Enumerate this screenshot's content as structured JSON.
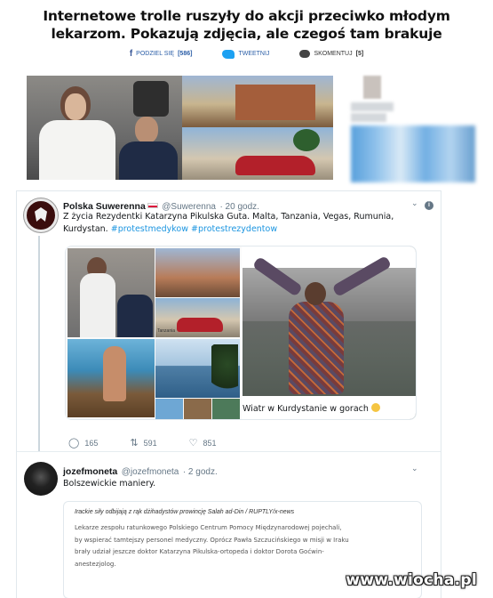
{
  "article": {
    "headline_line1": "Internetowe trolle ruszyły do akcji przeciwko młodym",
    "headline_line2": "lekarzom. Pokazują zdjęcia, ale czegoś tam brakuje",
    "share": {
      "facebook_label": "PODZIEL SIĘ",
      "facebook_count": "[586]",
      "twitter_label": "TWEETNIJ",
      "comment_label": "SKOMENTUJ",
      "comment_count": "[5]"
    }
  },
  "tweet1": {
    "name": "Polska Suwerenna",
    "handle": "@Suwerenna",
    "time": "· 20 godz.",
    "text_line1": "Z życia Rezydentki Katarzyna Pikulska Guta. Malta, Tanzania, Vegas, Rumunia,",
    "text_line2_plain": "Kurdystan. ",
    "hashtag1": "#protestmedykow",
    "hashtag2": "#protestrezydentow",
    "media_caption": "Wiatr w Kurdystanie w gorach",
    "collage_caption_small": "Tanzania",
    "replies": "165",
    "retweets": "591",
    "likes": "851",
    "info_icon": "i"
  },
  "tweet2": {
    "name": "jozefmoneta",
    "handle": "@jozefmoneta",
    "time": "· 2 godz.",
    "text": "Bolszewickie maniery.",
    "quote_header": "Irackie siły odbijają z rąk dżihadystów prowincję Salah ad-Din / RUPTLY/x-news",
    "quote_line1": "Lekarze zespołu ratunkowego Polskiego Centrum Pomocy Międzynarodowej pojechali,",
    "quote_line2": "by wspierać tamtejszy personel medyczny. Oprócz Pawła Szczucińskiego w misji w Iraku",
    "quote_line3": "brały udział jeszcze doktor Katarzyna Pikulska-ortopeda i doktor Dorota Goćwin-",
    "quote_line4": "anestezjolog."
  },
  "watermark": "www.wiocha.pl",
  "icons": {
    "facebook": "facebook-icon",
    "twitter": "twitter-bird-icon",
    "comment": "comment-bubble-icon",
    "reply": "reply-icon",
    "retweet": "retweet-icon",
    "like": "heart-icon",
    "chevron": "chevron-down-icon",
    "info": "info-icon"
  },
  "colors": {
    "twitter_blue": "#1da1f2",
    "hashtag": "#1b95e0",
    "facebook": "#3b5998"
  }
}
